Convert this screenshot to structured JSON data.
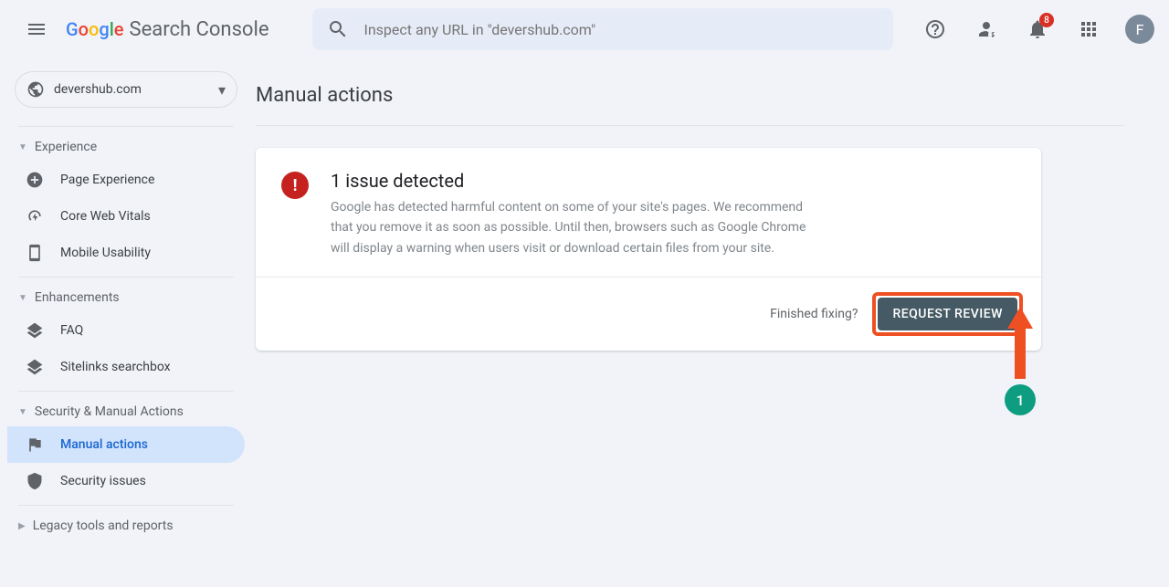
{
  "header": {
    "product_name": "Search Console",
    "search_placeholder": "Inspect any URL in \"devershub.com\"",
    "notification_count": "8",
    "avatar_letter": "F"
  },
  "sidebar": {
    "property": "devershub.com",
    "sections": {
      "experience": {
        "label": "Experience",
        "items": [
          "Page Experience",
          "Core Web Vitals",
          "Mobile Usability"
        ]
      },
      "enhancements": {
        "label": "Enhancements",
        "items": [
          "FAQ",
          "Sitelinks searchbox"
        ]
      },
      "security": {
        "label": "Security & Manual Actions",
        "items": [
          "Manual actions",
          "Security issues"
        ]
      },
      "legacy": {
        "label": "Legacy tools and reports"
      }
    }
  },
  "main": {
    "title": "Manual actions",
    "issue_heading": "1 issue detected",
    "issue_body": "Google has detected harmful content on some of your site's pages. We recommend that you remove it as soon as possible. Until then, browsers such as Google Chrome will display a warning when users visit or download certain files from your site.",
    "finished_label": "Finished fixing?",
    "request_button": "REQUEST REVIEW"
  },
  "annotation": {
    "step": "1"
  }
}
